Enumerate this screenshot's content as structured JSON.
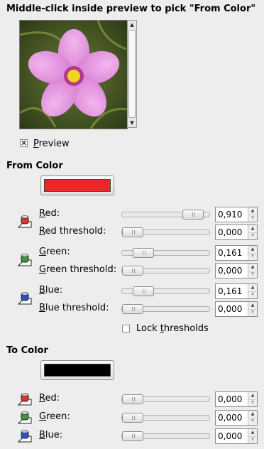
{
  "instruction": "Middle-click inside preview to pick \"From Color\"",
  "preview": {
    "label_pre": "",
    "label_u": "P",
    "label_post": "review",
    "checked": true
  },
  "from_color": {
    "heading": "From Color",
    "swatch": "#e8282a",
    "rows": [
      {
        "label_u": "R",
        "label_post": "ed:",
        "value": "0,910",
        "level": 0.91
      },
      {
        "label_u": "R",
        "label_post": "ed threshold:",
        "value": "0,000",
        "level": 0.0
      },
      {
        "label_u": "G",
        "label_post": "reen:",
        "value": "0,161",
        "level": 0.161
      },
      {
        "label_u": "G",
        "label_post": "reen threshold:",
        "value": "0,000",
        "level": 0.0
      },
      {
        "label_u": "B",
        "label_post": "lue:",
        "value": "0,161",
        "level": 0.161
      },
      {
        "label_u": "B",
        "label_post": "lue threshold:",
        "value": "0,000",
        "level": 0.0
      }
    ]
  },
  "lock": {
    "label_pre": "Lock ",
    "label_u": "t",
    "label_post": "hresholds",
    "checked": false
  },
  "to_color": {
    "heading": "To Color",
    "swatch": "#000000",
    "rows": [
      {
        "label_u": "R",
        "label_post": "ed:",
        "value": "0,000",
        "level": 0.0
      },
      {
        "label_u": "G",
        "label_post": "reen:",
        "value": "0,000",
        "level": 0.0
      },
      {
        "label_u": "B",
        "label_post": "lue:",
        "value": "0,000",
        "level": 0.0
      }
    ]
  },
  "icons": {
    "red": "red-channel-icon",
    "green": "green-channel-icon",
    "blue": "blue-channel-icon"
  },
  "colors": {
    "red": "#d8382e",
    "green": "#3a9a3a",
    "blue": "#3050c8"
  }
}
